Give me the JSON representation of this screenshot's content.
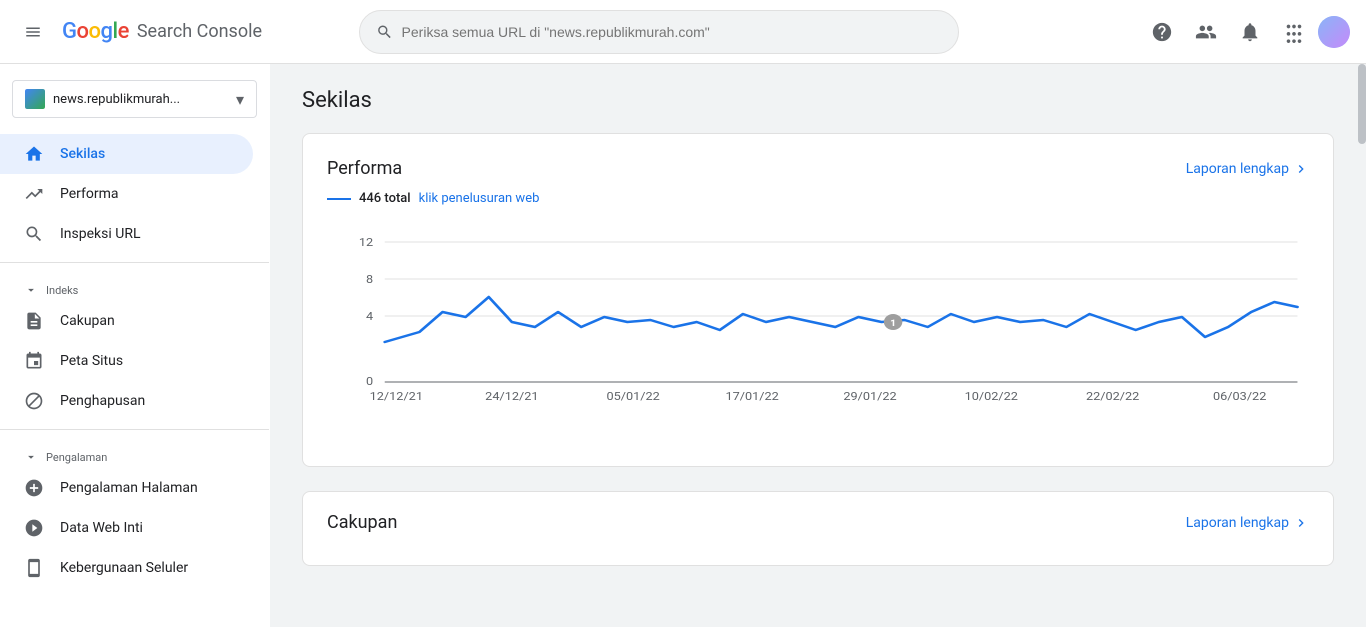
{
  "app": {
    "title": "Google Search Console",
    "logo_text": "Google",
    "app_name": "Search Console"
  },
  "topbar": {
    "menu_icon": "☰",
    "search_placeholder": "Periksa semua URL di \"news.republikmurah.com\"",
    "help_icon": "?",
    "user_icon": "👤",
    "notifications_icon": "🔔",
    "apps_icon": "⋮⋮⋮"
  },
  "sidebar": {
    "property": {
      "name": "news.republikmurah...",
      "chevron": "▾"
    },
    "nav_items": [
      {
        "id": "sekilas",
        "label": "Sekilas",
        "icon": "home",
        "active": true
      },
      {
        "id": "performa",
        "label": "Performa",
        "icon": "trending_up",
        "active": false
      },
      {
        "id": "inspeksi_url",
        "label": "Inspeksi URL",
        "icon": "search",
        "active": false
      }
    ],
    "sections": [
      {
        "label": "Indeks",
        "items": [
          {
            "id": "cakupan",
            "label": "Cakupan",
            "icon": "file"
          },
          {
            "id": "peta_situs",
            "label": "Peta Situs",
            "icon": "sitemap"
          },
          {
            "id": "penghapusan",
            "label": "Penghapusan",
            "icon": "blocked"
          }
        ]
      },
      {
        "label": "Pengalaman",
        "items": [
          {
            "id": "pengalaman_halaman",
            "label": "Pengalaman Halaman",
            "icon": "circle_plus"
          },
          {
            "id": "data_web_inti",
            "label": "Data Web Inti",
            "icon": "speed"
          },
          {
            "id": "kebergunaan_seluler",
            "label": "Kebergunaan Seluler",
            "icon": "phone"
          }
        ]
      }
    ]
  },
  "main": {
    "page_title": "Sekilas",
    "performa_card": {
      "title": "Performa",
      "link_text": "Laporan lengkap",
      "legend_total": "446 total",
      "legend_label": "klik penelusuran web",
      "chart": {
        "y_labels": [
          "12",
          "8",
          "4",
          "0"
        ],
        "x_labels": [
          "12/12/21",
          "24/12/21",
          "05/01/22",
          "17/01/22",
          "29/01/22",
          "10/02/22",
          "22/02/22",
          "06/03/22"
        ],
        "marker_position": "29/01/22"
      }
    },
    "cakupan_card": {
      "title": "Cakupan",
      "link_text": "Laporan lengkap"
    }
  },
  "colors": {
    "blue": "#1a73e8",
    "active_bg": "#e8f0fe",
    "chart_line": "#1a73e8",
    "grid_line": "#e0e0e0",
    "axis_text": "#5f6368"
  }
}
